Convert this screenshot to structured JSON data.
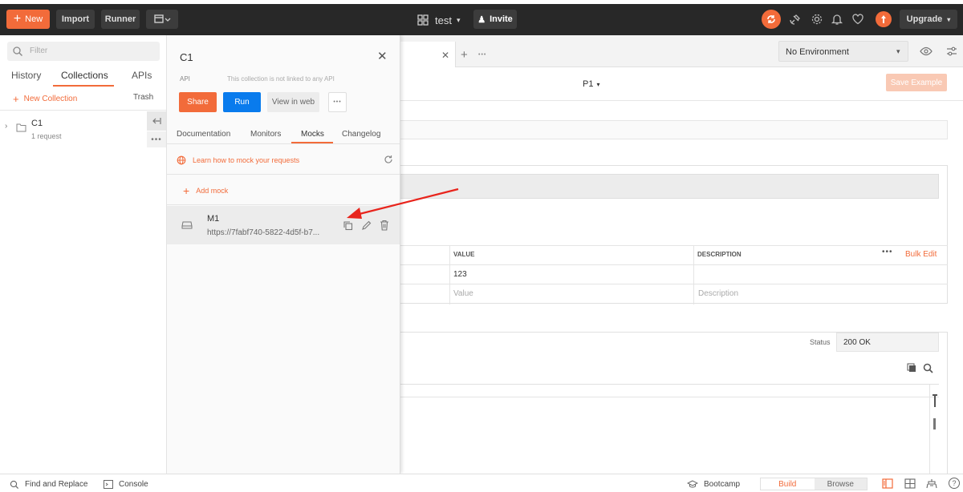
{
  "topbar": {
    "new_label": "New",
    "import_label": "Import",
    "runner_label": "Runner",
    "workspace_name": "test",
    "invite_label": "Invite",
    "upgrade_label": "Upgrade",
    "accent": "#f26b3a"
  },
  "sidebar": {
    "filter_placeholder": "Filter",
    "tabs": [
      "History",
      "Collections",
      "APIs"
    ],
    "active_tab": "Collections",
    "new_collection_label": "New Collection",
    "trash_label": "Trash",
    "collection": {
      "name": "C1",
      "meta": "1 request"
    }
  },
  "overlay": {
    "title": "C1",
    "api_label": "API",
    "api_note": "This collection is not linked to any API",
    "share_label": "Share",
    "run_label": "Run",
    "view_web_label": "View in web",
    "tabs": [
      "Documentation",
      "Monitors",
      "Mocks",
      "Changelog"
    ],
    "active_tab": "Mocks",
    "learn_link": "Learn how to mock your requests",
    "add_mock_label": "Add mock",
    "mock": {
      "name": "M1",
      "url": "https://7fabf740-5822-4d5f-b7..."
    }
  },
  "pane": {
    "environment": "No Environment",
    "example_name": "P1",
    "save_example_label": "Save Example",
    "table_headers": {
      "value": "VALUE",
      "description": "DESCRIPTION"
    },
    "bulk_edit_label": "Bulk Edit",
    "row_value": "123",
    "value_placeholder": "Value",
    "description_placeholder": "Description",
    "status_label": "Status",
    "status_value": "200 OK"
  },
  "statusbar": {
    "find_replace_label": "Find and Replace",
    "console_label": "Console",
    "bootcamp_label": "Bootcamp",
    "build_label": "Build",
    "browse_label": "Browse"
  }
}
